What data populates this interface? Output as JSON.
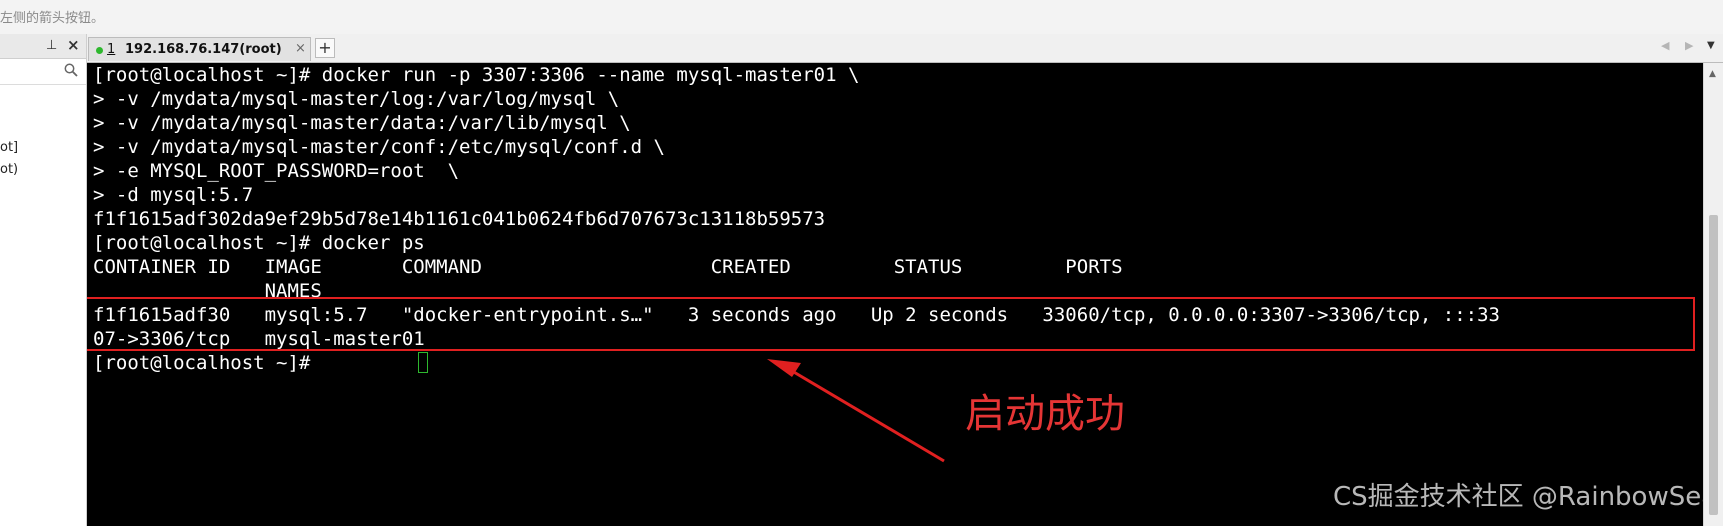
{
  "hint": {
    "text": "左侧的箭头按钮。"
  },
  "left_panel": {
    "search": {
      "placeholder": ""
    },
    "items": [
      {
        "label": "ot]"
      },
      {
        "label": "ot)"
      }
    ]
  },
  "tabs": [
    {
      "index": "1",
      "title": "192.168.76.147(root)",
      "close": "×",
      "status_color": "#2eb82e"
    }
  ],
  "tabbar": {
    "add_label": "+",
    "prev": "◀",
    "next": "▶",
    "menu": "▼"
  },
  "terminal": {
    "lines": [
      "[root@localhost ~]# docker run -p 3307:3306 --name mysql-master01 \\",
      "> -v /mydata/mysql-master/log:/var/log/mysql \\",
      "> -v /mydata/mysql-master/data:/var/lib/mysql \\",
      "> -v /mydata/mysql-master/conf:/etc/mysql/conf.d \\",
      "> -e MYSQL_ROOT_PASSWORD=root  \\",
      "> -d mysql:5.7",
      "f1f1615adf302da9ef29b5d78e14b1161c041b0624fb6d707673c13118b59573",
      "[root@localhost ~]# docker ps",
      "CONTAINER ID   IMAGE       COMMAND                    CREATED         STATUS         PORTS",
      "               NAMES",
      "f1f1615adf30   mysql:5.7   \"docker-entrypoint.s…\"   3 seconds ago   Up 2 seconds   33060/tcp, 0.0.0.0:3307->3306/tcp, :::33",
      "07->3306/tcp   mysql-master01",
      "[root@localhost ~]# "
    ]
  },
  "annotation": {
    "text": "启动成功",
    "color": "#e53535"
  },
  "watermark": {
    "text": "CS掘金技术社区 @RainbowSea"
  }
}
